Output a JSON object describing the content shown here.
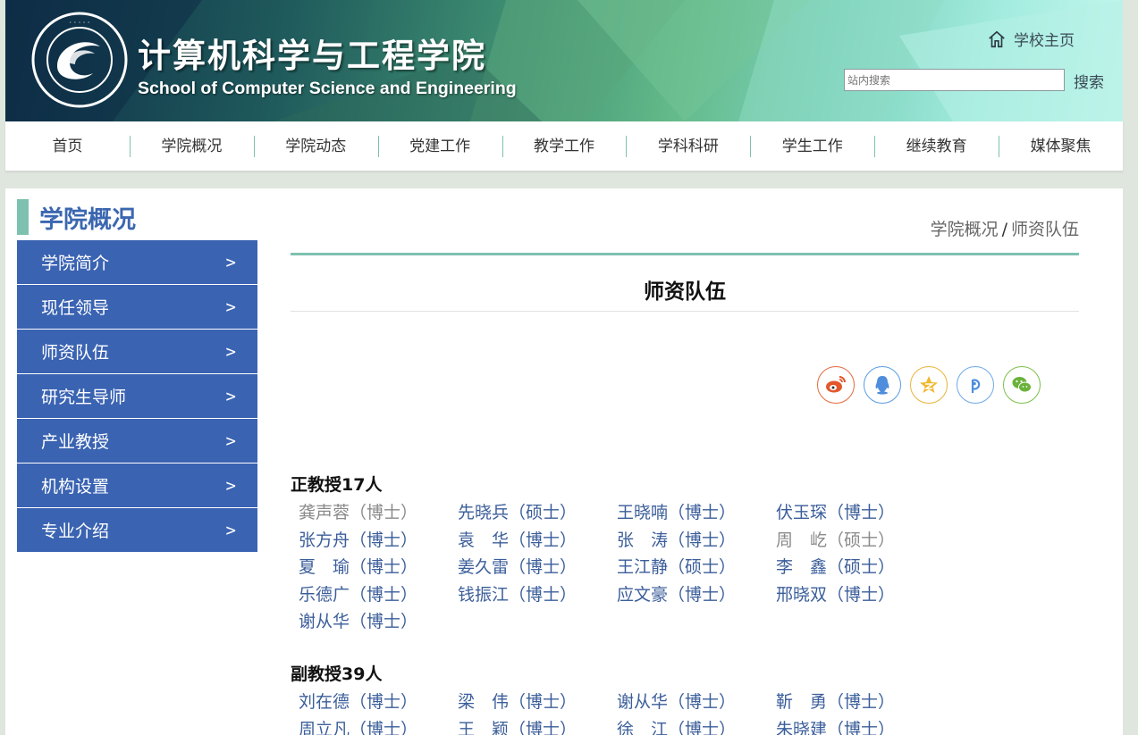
{
  "header": {
    "title_cn": "计算机科学与工程学院",
    "title_en": "School of Computer Science and Engineering",
    "home_link": "学校主页",
    "search_placeholder": "站内搜索",
    "search_button": "搜索"
  },
  "nav": [
    "首页",
    "学院概况",
    "学院动态",
    "党建工作",
    "教学工作",
    "学科科研",
    "学生工作",
    "继续教育",
    "媒体聚焦"
  ],
  "sidebar": {
    "title": "学院概况",
    "items": [
      "学院简介",
      "现任领导",
      "师资队伍",
      "研究生导师",
      "产业教授",
      "机构设置",
      "专业介绍"
    ],
    "chevron": ">"
  },
  "breadcrumb": {
    "parent": "学院概况",
    "separator": "/",
    "current": "师资队伍"
  },
  "page_title": "师资队伍",
  "share_icons": [
    "weibo-icon",
    "qq-icon",
    "qzone-icon",
    "pengyou-icon",
    "wechat-icon"
  ],
  "sections": [
    {
      "heading": "正教授17人",
      "names": [
        {
          "text": "龚声蓉（博士）",
          "visited": true
        },
        {
          "text": "先晓兵（硕士）",
          "visited": false
        },
        {
          "text": "王晓喃（博士）",
          "visited": false
        },
        {
          "text": "伏玉琛（博士）",
          "visited": false
        },
        {
          "text": "张方舟（博士）",
          "visited": false
        },
        {
          "text": "袁　华（博士）",
          "visited": false
        },
        {
          "text": "张　涛（博士）",
          "visited": false
        },
        {
          "text": "周　屹（硕士）",
          "visited": true
        },
        {
          "text": "夏　瑜（博士）",
          "visited": false
        },
        {
          "text": "姜久雷（博士）",
          "visited": false
        },
        {
          "text": "王江静（硕士）",
          "visited": false
        },
        {
          "text": "李　鑫（硕士）",
          "visited": false
        },
        {
          "text": "乐德广（博士）",
          "visited": false
        },
        {
          "text": "钱振江（博士）",
          "visited": false
        },
        {
          "text": "应文豪（博士）",
          "visited": false
        },
        {
          "text": "邢晓双（博士）",
          "visited": false
        },
        {
          "text": "谢从华（博士）",
          "visited": false
        }
      ]
    },
    {
      "heading": "副教授39人",
      "names": [
        {
          "text": "刘在德（博士）",
          "visited": false
        },
        {
          "text": "梁　伟（博士）",
          "visited": false
        },
        {
          "text": "谢从华（博士）",
          "visited": false
        },
        {
          "text": "靳　勇（博士）",
          "visited": false
        },
        {
          "text": "周立凡（博士）",
          "visited": false
        },
        {
          "text": "王　颖（博士）",
          "visited": false
        },
        {
          "text": "徐　江（博士）",
          "visited": false
        },
        {
          "text": "朱晓建（博士）",
          "visited": false
        }
      ]
    }
  ]
}
